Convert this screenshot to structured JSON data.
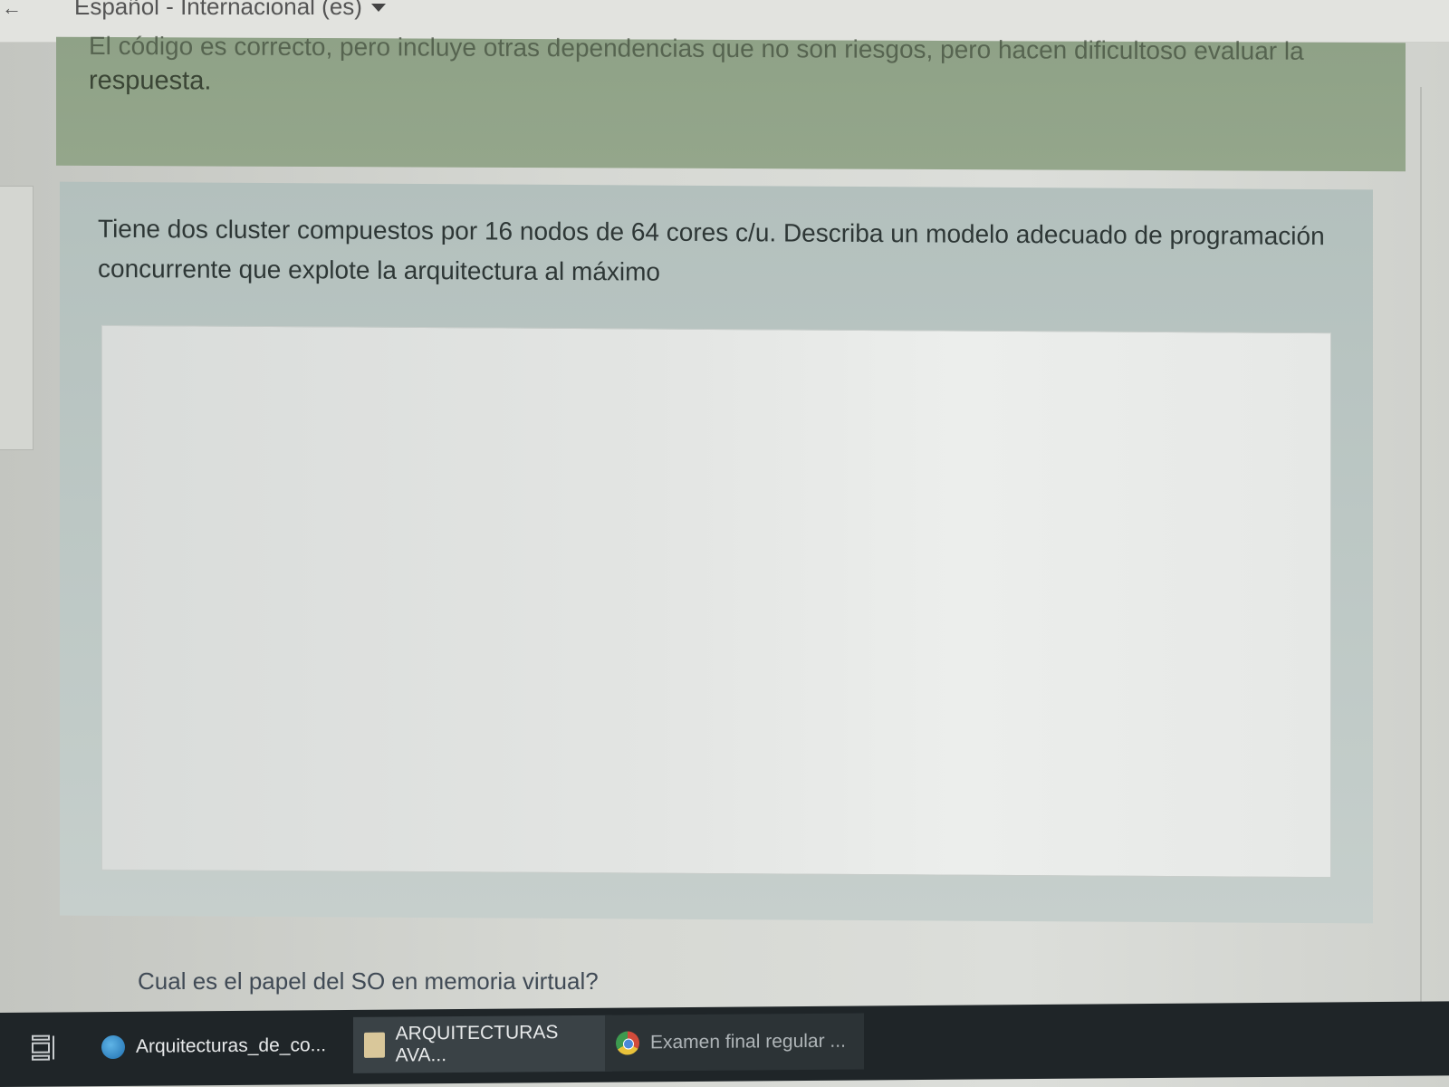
{
  "language_bar": {
    "back_glyph": "←",
    "selected_language": "Español - Internacional (es)"
  },
  "feedback": {
    "partial_line": "El código es correcto, pero incluye otras dependencias que no son riesgos, pero hacen dificultoso evaluar la",
    "line": "respuesta."
  },
  "question": {
    "text": "Tiene dos cluster compuestos por 16 nodos de 64 cores c/u. Describa un modelo adecuado de programación concurrente que explote la arquitectura al máximo",
    "answer_value": ""
  },
  "next_question": {
    "text": "Cual es el papel del SO en memoria virtual?"
  },
  "taskbar": {
    "items": [
      {
        "label": "Arquitecturas_de_co...",
        "icon": "edge-icon"
      },
      {
        "label": "ARQUITECTURAS AVA...",
        "icon": "word-icon"
      },
      {
        "label": "Examen final regular ...",
        "icon": "chrome-icon"
      }
    ]
  }
}
